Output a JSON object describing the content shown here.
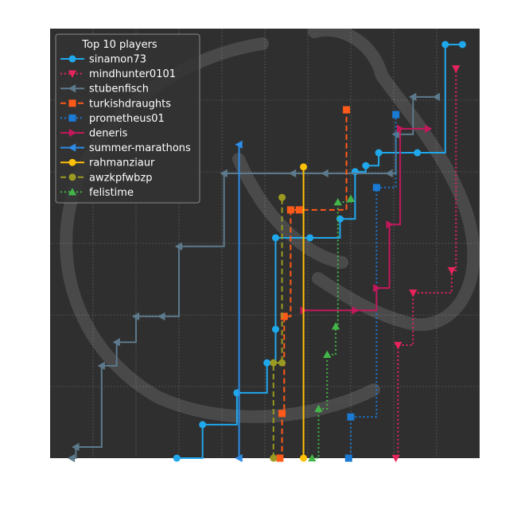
{
  "chart_data": {
    "type": "line",
    "step": true,
    "title": "",
    "xlabel": "",
    "ylabel": "",
    "xlim": [
      0,
      100
    ],
    "ylim": [
      0,
      100
    ],
    "show_tick_labels": false,
    "grid": true,
    "background": "#2f2f2f",
    "grid_color": "#5a5a5a",
    "watermark": "knight-head-logo",
    "legend": {
      "title": "Top 10 players",
      "placement": "top-left"
    },
    "series": [
      {
        "name": "sinamon73",
        "color": "#1fa8ec",
        "marker": "circle",
        "dash": "solid",
        "x": [
          29.5,
          35.5,
          43.5,
          50.5,
          52.5,
          52.5,
          60.5,
          67.5,
          71.0,
          73.5,
          76.5,
          85.5,
          92.0,
          96.0
        ],
        "y": [
          0,
          7.8,
          15.2,
          22.2,
          30.0,
          51.3,
          51.3,
          55.7,
          66.7,
          68.1,
          71.1,
          71.1,
          96.3,
          96.3
        ]
      },
      {
        "name": "mindhunter0101",
        "color": "#e8245c",
        "marker": "triangle-down",
        "dash": "dotted",
        "x": [
          80.5,
          81.0,
          84.5,
          93.5,
          94.5
        ],
        "y": [
          0,
          26.3,
          38.5,
          43.7,
          90.7
        ]
      },
      {
        "name": "stubenfisch",
        "color": "#5d7a8c",
        "marker": "triangle-left",
        "dash": "solid",
        "x": [
          5.0,
          6.0,
          12.0,
          15.5,
          20.0,
          26.0,
          30.0,
          40.5,
          56.5,
          64.0,
          79.0,
          80.5,
          84.5,
          90.0
        ],
        "y": [
          0,
          2.6,
          21.5,
          27.0,
          33.0,
          33.0,
          49.3,
          66.3,
          66.3,
          66.3,
          66.3,
          75.4,
          84.1,
          84.1
        ]
      },
      {
        "name": "turkishdraughts",
        "color": "#ff5a1a",
        "marker": "square",
        "dash": "dashed",
        "x": [
          53.5,
          54.0,
          54.5,
          56.0,
          58.0,
          69.0
        ],
        "y": [
          0,
          10.4,
          33.0,
          57.8,
          57.8,
          81.1
        ]
      },
      {
        "name": "prometheus01",
        "color": "#1a7ad4",
        "marker": "square",
        "dash": "dotted",
        "x": [
          69.5,
          70.0,
          76.0,
          80.5
        ],
        "y": [
          0,
          9.6,
          63.0,
          80.0
        ]
      },
      {
        "name": "deneris",
        "color": "#c2185b",
        "marker": "triangle-right",
        "dash": "solid",
        "x": [
          59.0,
          71.0,
          76.0,
          79.0,
          81.5,
          88.0
        ],
        "y": [
          34.4,
          34.4,
          39.6,
          54.4,
          76.7,
          76.7
        ]
      },
      {
        "name": "summer-marathons",
        "color": "#2e8be6",
        "marker": "triangle-left",
        "dash": "solid",
        "x": [
          44.0,
          44.0
        ],
        "y": [
          0,
          73.0
        ]
      },
      {
        "name": "rahmanziaur",
        "color": "#ffc107",
        "marker": "circle",
        "dash": "solid",
        "x": [
          59.0,
          59.0
        ],
        "y": [
          0,
          67.8
        ]
      },
      {
        "name": "awzkpfwbzp",
        "color": "#9a9a22",
        "marker": "circle",
        "dash": "dashed",
        "x": [
          52.0,
          52.0,
          54.0,
          54.0
        ],
        "y": [
          0,
          22.2,
          22.2,
          60.7
        ]
      },
      {
        "name": "felistime",
        "color": "#43b649",
        "marker": "triangle-up",
        "dash": "dotted",
        "x": [
          61.0,
          62.5,
          64.5,
          66.5,
          67.0,
          70.0
        ],
        "y": [
          0,
          11.5,
          24.1,
          30.7,
          59.6,
          60.4
        ]
      }
    ]
  }
}
